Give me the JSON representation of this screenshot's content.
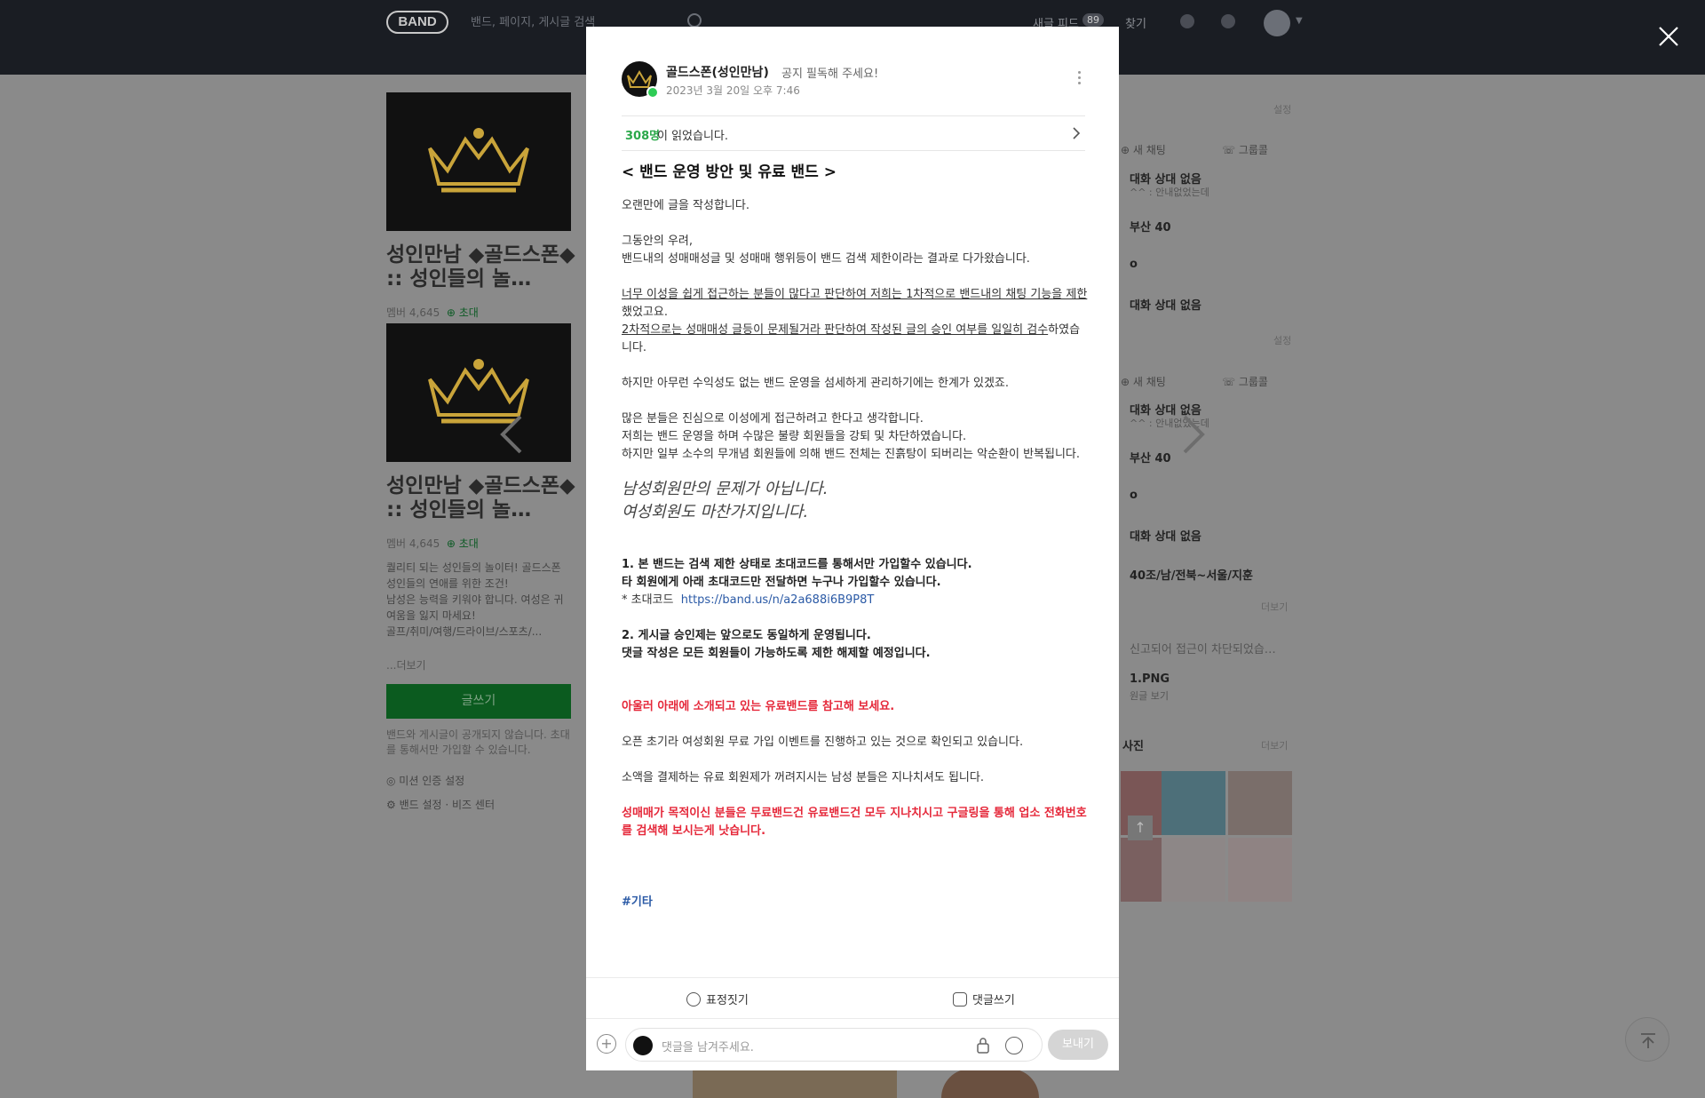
{
  "header": {
    "logo": "BAND",
    "search_placeholder": "밴드, 페이지, 게시글 검색",
    "nav_new_feed": "새글 피드",
    "nav_new_feed_count": "89",
    "nav_find": "찾기"
  },
  "left_panel": {
    "band_title": "성인만남 ◆골드스폰◆ :: 성인들의 놀…",
    "member_label": "멤버 4,645",
    "invite_label": "초대",
    "description": "퀄리티 되는 성인들의 놀이터! 골드스폰\n성인들의 연애를 위한 조건!\n남성은 능력을 키워야 합니다. 여성은 귀여움을 잃지 마세요!\n골프/취미/여행/드라이브/스포츠/...",
    "more": "...더보기",
    "write_button": "글쓰기",
    "privacy_note": "밴드와 게시글이 공개되지 않습니다. 초대를 통해서만 가입할 수 있습니다.",
    "mission_link": "미션 인증 설정",
    "settings_link": "밴드 설정",
    "biz_link": "비즈 센터"
  },
  "right_panel": {
    "setting": "설정",
    "new_chat": "새 채팅",
    "group_call": "그룹콜",
    "chats_1": [
      "대화 상대 없음",
      "^^ : 안내없었는데",
      "부산 40",
      "o",
      "대화 상대 없음"
    ],
    "chats_2": [
      "대화 상대 없음",
      "^^ : 안내없었는데",
      "부산 40",
      "o",
      "대화 상대 없음",
      "40조/남/전북~서울/지훈"
    ],
    "more": "더보기",
    "file_notice": "신고되어 접근이 차단되었습…",
    "file_name": "1.PNG",
    "file_sub": "원글 보기",
    "photos_title": "사진"
  },
  "post": {
    "author": "골드스폰(성인만남)",
    "notice": "공지 필독해 주세요!",
    "date": "2023년 3월 20일 오후 7:46",
    "read_count": "308명",
    "read_text": "이 읽었습니다.",
    "heading": "< 밴드 운영 방안 및 유료 밴드 >",
    "p1": "오랜만에 글을 작성합니다.",
    "p2a": "그동안의 우려,",
    "p2b": "밴드내의 성매매성글 및 성매매 행위등이 밴드 검색 제한이라는 결과로 다가왔습니다.",
    "p3a": "너무 이성을 쉽게 접근하는 분들이 많다고 판단하여 저희는 1차적으로 밴드내의 채팅 기능을 제한",
    "p3a_tail": "했었고요.",
    "p3b": "2차적으로는 성매매성 글등이 문제될거라 판단하여 작성된 글의 승인 여부를 일일히 검수",
    "p3b_tail": "하였습니다.",
    "p4": "하지만 아무런 수익성도 없는 밴드 운영을 섬세하게 관리하기에는 한계가 있겠죠.",
    "p5a": "많은 분들은 진심으로 이성에게 접근하려고 한다고 생각합니다.",
    "p5b": "저희는 밴드 운영을 하며 수많은 불량 회원들을 강퇴 및 차단하였습니다.",
    "p5c": "하지만 일부 소수의 무개념 회원들에 의해 밴드 전체는 진흙탕이 되버리는 악순환이 반복됩니다.",
    "italic1": "남성회원만의 문제가 아닙니다.",
    "italic2": "여성회원도 마찬가지입니다.",
    "b1a": "1. 본 밴드는 검색 제한 상태로 초대코드를 통해서만 가입할수 있습니다.",
    "b1b": "타 회원에게 아래 초대코드만 전달하면 누구나 가입할수 있습니다.",
    "code_label": "* 초대코드",
    "code_link": "https://band.us/n/a2a688i6B9P8T",
    "b2a": "2. 게시글 승인제는 앞으로도 동일하게 운영됩니다.",
    "b2b": "댓글 작성은 모든 회원들이 가능하도록 제한 해제할 예정입니다.",
    "red1": "아울러 아래에 소개되고 있는 유료밴드를 참고해 보세요.",
    "p6": "오픈 초기라 여성회원 무료 가입 이벤트를 진행하고 있는 것으로 확인되고 있습니다.",
    "p7": "소액을 결제하는 유료 회원제가 꺼려지시는 남성 분들은 지나치셔도 됩니다.",
    "red2": "성매매가 목적이신 분들은 무료밴드건 유료밴드건 모두 지나치시고 구글링을 통해 업소 전화번호를 검색해 보시는게 낫습니다.",
    "hashtag": "#기타",
    "action_emotion": "표정짓기",
    "action_comment": "댓글쓰기",
    "comment_placeholder": "댓글을 남겨주세요.",
    "send": "보내기"
  }
}
